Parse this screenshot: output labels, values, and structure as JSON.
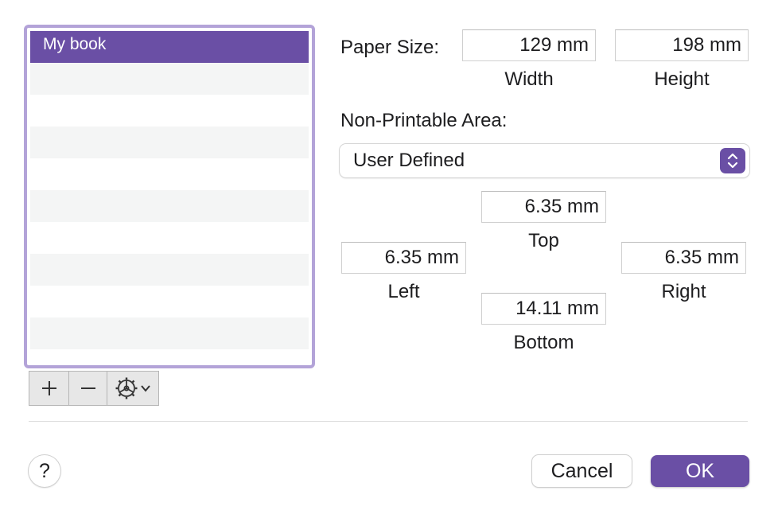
{
  "list": {
    "items": [
      {
        "label": "My book",
        "selected": true
      }
    ]
  },
  "list_controls": {
    "add_icon": "plus-icon",
    "remove_icon": "minus-icon",
    "action_icon": "gear-icon",
    "action_menu_icon": "chevron-down-icon"
  },
  "paper_size": {
    "label": "Paper Size:",
    "width_value": "129 mm",
    "width_caption": "Width",
    "height_value": "198 mm",
    "height_caption": "Height"
  },
  "non_printable": {
    "label": "Non-Printable Area:",
    "selected_option": "User Defined",
    "top_value": "6.35 mm",
    "top_caption": "Top",
    "left_value": "6.35 mm",
    "left_caption": "Left",
    "right_value": "6.35 mm",
    "right_caption": "Right",
    "bottom_value": "14.11 mm",
    "bottom_caption": "Bottom"
  },
  "footer": {
    "help_label": "?",
    "cancel_label": "Cancel",
    "ok_label": "OK"
  },
  "colors": {
    "accent": "#6a4fa5",
    "list_border": "#b3a3d8",
    "stripe": "#f4f5f5"
  }
}
